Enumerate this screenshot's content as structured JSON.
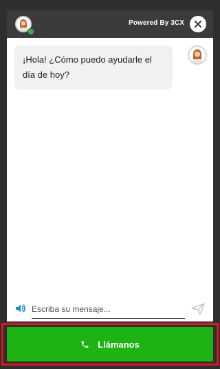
{
  "header": {
    "powered_by": "Powered By 3CX",
    "agent_status": "online",
    "icons": {
      "avatar": "agent-avatar-icon",
      "close": "close-icon"
    }
  },
  "chat": {
    "messages": [
      {
        "sender": "agent",
        "text": "¡Hola! ¿Cómo puedo ayudarle el día de hoy?"
      }
    ]
  },
  "composer": {
    "placeholder": "Escriba su mensaje...",
    "value": "",
    "icons": {
      "speaker": "speaker-icon",
      "send": "send-icon"
    }
  },
  "call_button": {
    "label": "Llámanos",
    "icon": "phone-icon",
    "highlight_color": "#e0161e",
    "color": "#1db312"
  },
  "colors": {
    "frame": "#2f2f2f",
    "header": "#3b3b3b",
    "status_online": "#3cb34a",
    "accent": "#1a8bd6"
  }
}
